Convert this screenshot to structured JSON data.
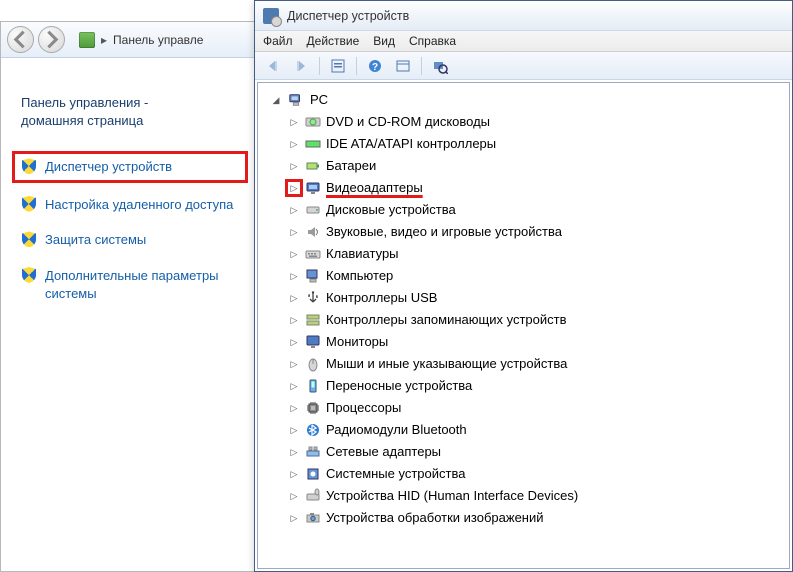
{
  "control_panel": {
    "breadcrumb": "Панель управле",
    "home_line1": "Панель управления -",
    "home_line2": "домашняя страница",
    "links": {
      "device_manager": "Диспетчер устройств",
      "remote_settings": "Настройка удаленного доступа",
      "system_protection": "Защита системы",
      "advanced_settings": "Дополнительные параметры системы"
    }
  },
  "device_manager": {
    "title": "Диспетчер устройств",
    "menu": {
      "file": "Файл",
      "action": "Действие",
      "view": "Вид",
      "help": "Справка"
    },
    "root": "PC",
    "categories": [
      {
        "label": "DVD и CD-ROM дисководы",
        "icon": "disc"
      },
      {
        "label": "IDE ATA/ATAPI контроллеры",
        "icon": "ide"
      },
      {
        "label": "Батареи",
        "icon": "battery"
      },
      {
        "label": "Видеоадаптеры",
        "icon": "display",
        "highlight": true
      },
      {
        "label": "Дисковые устройства",
        "icon": "drive"
      },
      {
        "label": "Звуковые, видео и игровые устройства",
        "icon": "sound"
      },
      {
        "label": "Клавиатуры",
        "icon": "keyboard"
      },
      {
        "label": "Компьютер",
        "icon": "computer"
      },
      {
        "label": "Контроллеры USB",
        "icon": "usb"
      },
      {
        "label": "Контроллеры запоминающих устройств",
        "icon": "storage"
      },
      {
        "label": "Мониторы",
        "icon": "monitor"
      },
      {
        "label": "Мыши и иные указывающие устройства",
        "icon": "mouse"
      },
      {
        "label": "Переносные устройства",
        "icon": "portable"
      },
      {
        "label": "Процессоры",
        "icon": "cpu"
      },
      {
        "label": "Радиомодули Bluetooth",
        "icon": "bluetooth"
      },
      {
        "label": "Сетевые адаптеры",
        "icon": "network"
      },
      {
        "label": "Системные устройства",
        "icon": "system"
      },
      {
        "label": "Устройства HID (Human Interface Devices)",
        "icon": "hid"
      },
      {
        "label": "Устройства обработки изображений",
        "icon": "imaging"
      }
    ]
  }
}
